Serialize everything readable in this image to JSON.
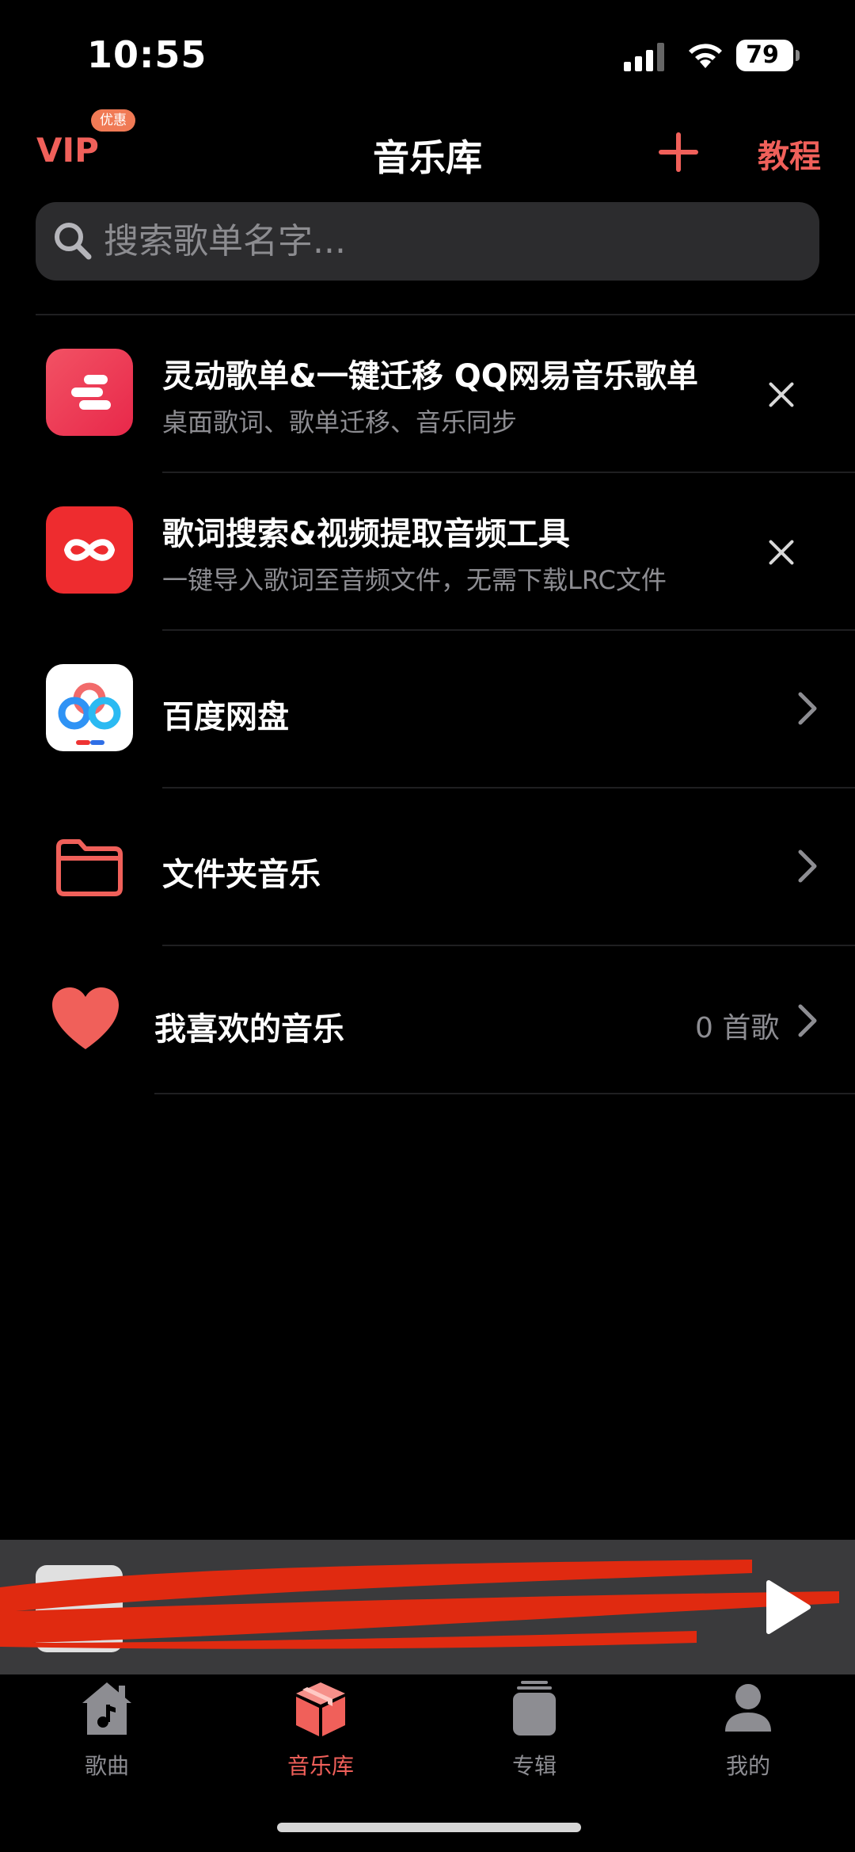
{
  "status_bar": {
    "time": "10:55",
    "battery": "79"
  },
  "header": {
    "vip_label": "VIP",
    "promo_badge": "优惠",
    "title": "音乐库",
    "tutorial_label": "教程"
  },
  "search": {
    "placeholder": "搜索歌单名字..."
  },
  "list": {
    "items": [
      {
        "title": "灵动歌单&一键迁移 QQ网易音乐歌单",
        "subtitle": "桌面歌词、歌单迁移、音乐同步"
      },
      {
        "title": "歌词搜索&视频提取音频工具",
        "subtitle": "一键导入歌词至音频文件，无需下载LRC文件"
      },
      {
        "title": "百度网盘"
      },
      {
        "title": "文件夹音乐"
      },
      {
        "title": "我喜欢的音乐",
        "count": "0 首歌"
      }
    ]
  },
  "tab_bar": {
    "tabs": [
      {
        "label": "歌曲",
        "icon": "home-music-icon"
      },
      {
        "label": "音乐库",
        "icon": "box-icon",
        "active": true
      },
      {
        "label": "专辑",
        "icon": "album-stack-icon"
      },
      {
        "label": "我的",
        "icon": "person-icon"
      }
    ]
  },
  "colors": {
    "accent": "#f0605a",
    "background": "#000000",
    "search_bg": "#2c2c2e",
    "player_bg": "#3a3a3c"
  }
}
